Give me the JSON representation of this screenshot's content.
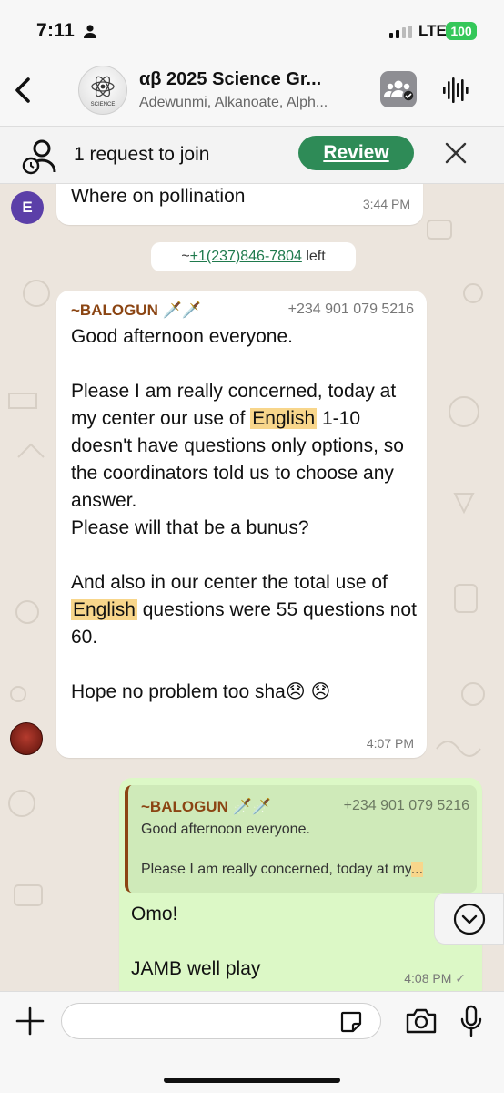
{
  "status_bar": {
    "time": "7:11",
    "network": "LTE",
    "battery": "100"
  },
  "header": {
    "back_icon": "chevron-left-icon",
    "avatar_label": "SCIENCE",
    "title": "αβ 2025 Science Gr...",
    "members": "Adewunmi, Alkanoate, Alph..."
  },
  "join_banner": {
    "text": "1 request to join",
    "review_label": "Review"
  },
  "messages": {
    "m1": {
      "avatar_letter": "E",
      "text": "Where on pollination",
      "time": "3:44 PM"
    },
    "system": {
      "prefix": "~",
      "phone": "+1(237)846-7804",
      "suffix": " left"
    },
    "m2": {
      "sender": "~BALOGUN 🗡️🗡️",
      "phone": "+234 901 079 5216",
      "t1": "Good afternoon everyone.\n\nPlease I am really concerned, today at my center our use of ",
      "hl1": "English",
      "t2": " 1-10 doesn't have questions only options, so the coordinators told us to choose any answer.\nPlease will that be a bunus?\n\nAnd also in our center the total use of ",
      "hl2": "English",
      "t3": " questions were 55 questions not 60.\n\nHope no problem too sha😞 😞",
      "time": "4:07 PM"
    },
    "m3": {
      "quote_sender": "~BALOGUN 🗡️🗡️",
      "quote_phone": "+234 901 079 5216",
      "quote_line1": "Good afternoon everyone.",
      "quote_line2": "Please I am really concerned, today at my",
      "quote_ellipsis": "...",
      "reply_line1": "Omo!",
      "reply_line2": "JAMB well play",
      "time": "4:08 PM",
      "tick": "✓"
    }
  },
  "composer": {
    "placeholder": ""
  },
  "colors": {
    "accent": "#2e8b57",
    "outgoing_bubble": "#dcf8c6",
    "sender_name": "#8b4513",
    "highlight": "#f8d68b"
  }
}
